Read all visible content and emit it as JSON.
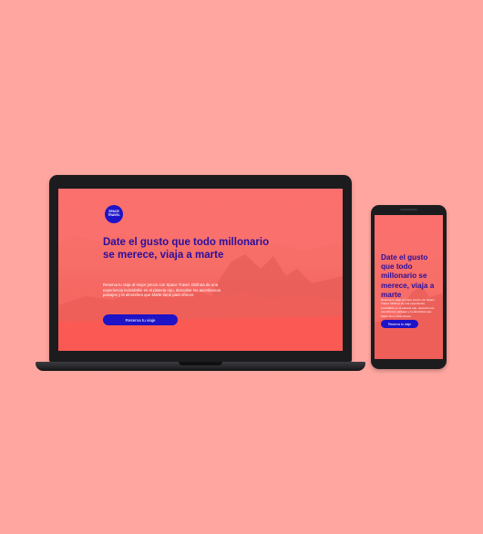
{
  "brand": {
    "logo_line1": "SPACE",
    "logo_line2": "TRAVEL"
  },
  "hero": {
    "title": "Date el gusto que todo millonario se merece, viaja a marte",
    "description": "Reserva tu viaje al mejor precio con Space Travel. Disfruta de una experiencia inolvidable en el planeta rojo, descubre los asombrosos paisajes y la atmósfera que Marte tiene para ofrecer.",
    "cta_label": "Reserva tu viaje"
  },
  "colors": {
    "background": "#ffa6a0",
    "screen": "#f9716c",
    "title": "#2a0f9e",
    "button": "#1e13c7",
    "device": "#1c1c1f"
  }
}
